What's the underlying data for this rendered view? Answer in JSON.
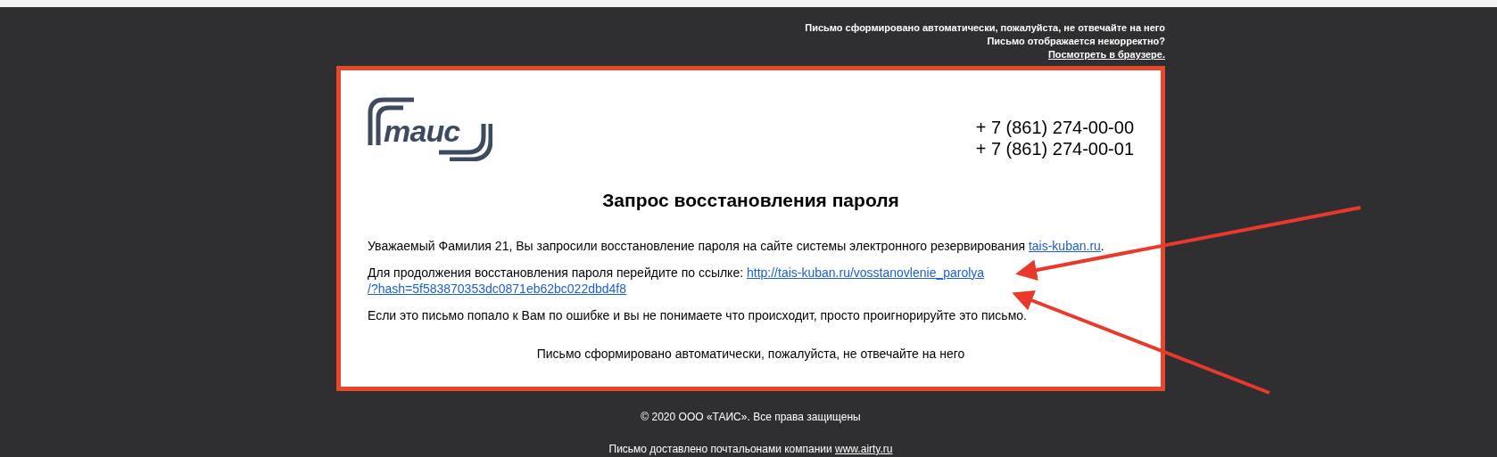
{
  "notice": {
    "auto": "Письмо сформировано автоматически, пожалуйста, не отвечайте на него",
    "incorrect": "Письмо отображается некорректно?",
    "view_link": "Посмотреть в браузере."
  },
  "email": {
    "logo_text": "таис",
    "phones": [
      "+ 7 (861) 274-00-00",
      "+ 7 (861) 274-00-01"
    ],
    "title": "Запрос восстановления пароля",
    "greeting": "Уважаемый Фамилия 21, Вы запросили восстановление пароля на сайте системы электронного резервирования ",
    "greeting_link": "tais-kuban.ru",
    "greeting_end": ".",
    "reset_text": "Для продолжения восстановления пароля перейдите по ссылке: ",
    "reset_link": [
      "http://tais-kuban.ru/vosstanovlenie_parolya",
      "/?hash=5f583870353dc0871eb62bc022dbd4f8"
    ],
    "ignore_text": "Если это письмо попало к Вам по ошибке и вы не понимаете что происходит, просто проигнорируйте это письмо.",
    "auto_note": "Письмо сформировано автоматически, пожалуйста, не отвечайте на него"
  },
  "footer": {
    "copyright": "© 2020 ООО «ТАИС». Все права защищены",
    "delivered": "Письмо доставлено почтальонами компании ",
    "delivered_link": "www.airty.ru"
  }
}
